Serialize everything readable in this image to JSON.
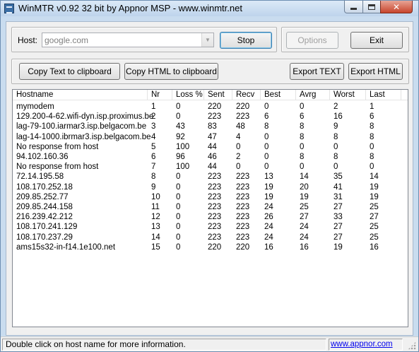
{
  "window": {
    "title": "WinMTR v0.92 32 bit by Appnor MSP - www.winmtr.net",
    "min_icon": "minimize-icon",
    "max_icon": "maximize-icon",
    "close_icon": "close-icon",
    "close_glyph": "✕"
  },
  "host": {
    "label": "Host:",
    "value": "google.com",
    "dropdown_glyph": "▼"
  },
  "buttons": {
    "stop": "Stop",
    "options": "Options",
    "exit": "Exit",
    "copy_text": "Copy Text to clipboard",
    "copy_html": "Copy HTML to clipboard",
    "export_text": "Export TEXT",
    "export_html": "Export HTML"
  },
  "table": {
    "columns": [
      "Hostname",
      "Nr",
      "Loss %",
      "Sent",
      "Recv",
      "Best",
      "Avrg",
      "Worst",
      "Last"
    ],
    "rows": [
      [
        "mymodem",
        "1",
        "0",
        "220",
        "220",
        "0",
        "0",
        "2",
        "1"
      ],
      [
        "129.200-4-62.wifi-dyn.isp.proximus.be",
        "2",
        "0",
        "223",
        "223",
        "6",
        "6",
        "16",
        "6"
      ],
      [
        "lag-79-100.iarmar3.isp.belgacom.be",
        "3",
        "43",
        "83",
        "48",
        "8",
        "8",
        "9",
        "8"
      ],
      [
        "lag-14-1000.ibrmar3.isp.belgacom.be",
        "4",
        "92",
        "47",
        "4",
        "0",
        "8",
        "8",
        "8"
      ],
      [
        "No response from host",
        "5",
        "100",
        "44",
        "0",
        "0",
        "0",
        "0",
        "0"
      ],
      [
        "94.102.160.36",
        "6",
        "96",
        "46",
        "2",
        "0",
        "8",
        "8",
        "8"
      ],
      [
        "No response from host",
        "7",
        "100",
        "44",
        "0",
        "0",
        "0",
        "0",
        "0"
      ],
      [
        "72.14.195.58",
        "8",
        "0",
        "223",
        "223",
        "13",
        "14",
        "35",
        "14"
      ],
      [
        "108.170.252.18",
        "9",
        "0",
        "223",
        "223",
        "19",
        "20",
        "41",
        "19"
      ],
      [
        "209.85.252.77",
        "10",
        "0",
        "223",
        "223",
        "19",
        "19",
        "31",
        "19"
      ],
      [
        "209.85.244.158",
        "11",
        "0",
        "223",
        "223",
        "24",
        "25",
        "27",
        "25"
      ],
      [
        "216.239.42.212",
        "12",
        "0",
        "223",
        "223",
        "26",
        "27",
        "33",
        "27"
      ],
      [
        "108.170.241.129",
        "13",
        "0",
        "223",
        "223",
        "24",
        "24",
        "27",
        "25"
      ],
      [
        "108.170.237.29",
        "14",
        "0",
        "223",
        "223",
        "24",
        "24",
        "27",
        "25"
      ],
      [
        "ams15s32-in-f14.1e100.net",
        "15",
        "0",
        "220",
        "220",
        "16",
        "16",
        "19",
        "16"
      ]
    ]
  },
  "status": {
    "message": "Double click on host name for more information.",
    "link": "www.appnor.com"
  }
}
